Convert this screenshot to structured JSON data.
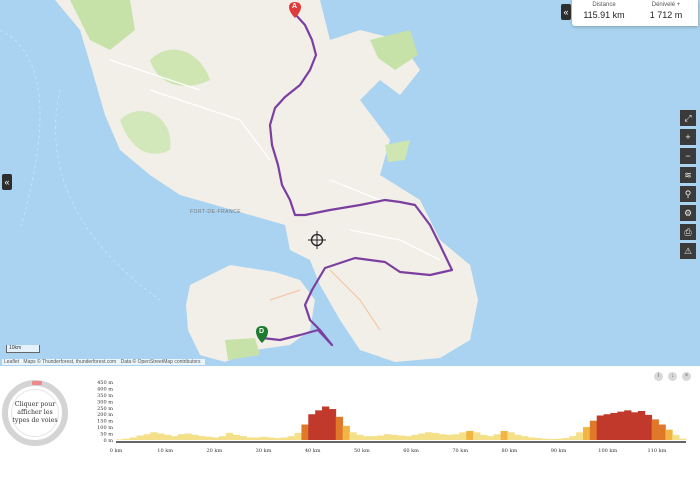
{
  "stats": {
    "distance_label": "Distance",
    "distance_value": "115.91 km",
    "elevation_label": "Dénivelé +",
    "elevation_value": "1 712 m"
  },
  "map": {
    "start_marker": "A",
    "end_marker": "D",
    "city_label": "FORT-DE-FRANCE",
    "scale_label": "10km",
    "attribution": [
      "Leaflet",
      "Maps © Thunderforest, thunderforest.com",
      "Data © OpenStreetMap contributors"
    ],
    "colors": {
      "sea": "#a9d3f0",
      "land": "#f2efe9",
      "route": "#7b3fa0",
      "start": "#e03b3b",
      "end": "#1e7a2e"
    }
  },
  "toolbar": {
    "icons": [
      "fullscreen-icon",
      "zoom-in-icon",
      "zoom-out-icon",
      "layers-icon",
      "bike-icon",
      "settings-icon",
      "print-icon",
      "warning-icon"
    ]
  },
  "road_types": {
    "text": "Cliquer pour afficher les types de voies"
  },
  "profile": {
    "y_ticks": [
      "450 m",
      "400 m",
      "350 m",
      "300 m",
      "250 m",
      "200 m",
      "150 m",
      "100 m",
      "50 m",
      "0 m"
    ],
    "x_ticks": [
      "0 km",
      "10 km",
      "20 km",
      "30 km",
      "40 km",
      "50 km",
      "60 km",
      "70 km",
      "80 km",
      "90 km",
      "100 km",
      "110 km"
    ],
    "elevations_m": [
      5,
      10,
      20,
      35,
      45,
      60,
      50,
      40,
      30,
      45,
      50,
      40,
      30,
      25,
      20,
      30,
      55,
      40,
      30,
      20,
      20,
      25,
      20,
      15,
      20,
      30,
      55,
      120,
      200,
      230,
      260,
      240,
      180,
      110,
      60,
      40,
      30,
      30,
      35,
      45,
      40,
      35,
      30,
      40,
      50,
      60,
      55,
      45,
      40,
      45,
      60,
      70,
      60,
      40,
      30,
      45,
      70,
      60,
      40,
      30,
      20,
      15,
      10,
      8,
      10,
      15,
      30,
      60,
      100,
      150,
      190,
      200,
      210,
      220,
      230,
      215,
      225,
      195,
      160,
      120,
      80,
      40,
      10
    ],
    "max_m": 450,
    "max_km": 115.91
  }
}
